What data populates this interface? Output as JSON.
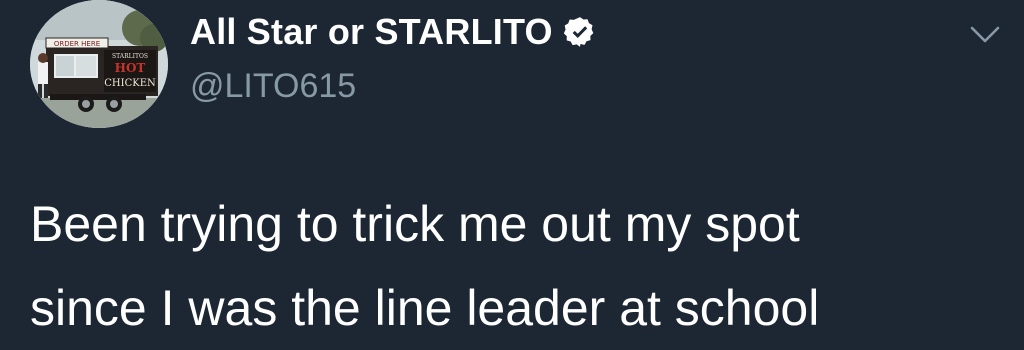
{
  "tweet": {
    "author": {
      "display_name": "All Star or STARLITO",
      "handle": "@LITO615",
      "verified": true,
      "avatar": {
        "sign_order": "ORDER HERE",
        "sign_brand": "STARLITOS",
        "sign_hot": "HOT",
        "sign_chicken": "CHICKEN"
      }
    },
    "text": "Been trying to trick me out my spot\nsince I was the line leader at school",
    "menu_icon": "chevron-down-icon"
  },
  "colors": {
    "background": "#1c2733",
    "text": "#ffffff",
    "muted": "#8899a6",
    "verified_badge": "#ffffff"
  }
}
